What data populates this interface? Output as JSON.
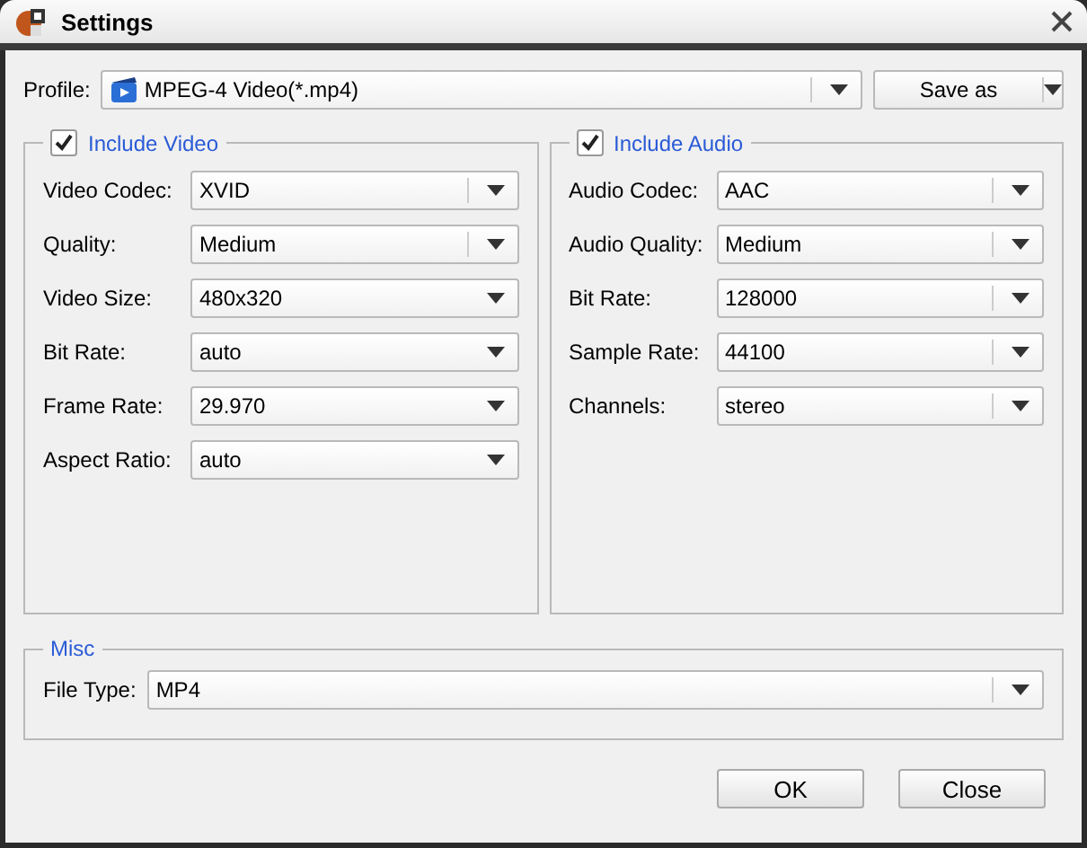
{
  "window": {
    "title": "Settings"
  },
  "profile": {
    "label": "Profile:",
    "value": "MPEG-4 Video(*.mp4)"
  },
  "save_as": {
    "label": "Save as"
  },
  "groups": [
    {
      "title": "Include Video",
      "checked": true,
      "fields": [
        {
          "label": "Video Codec:",
          "value": "XVID",
          "kind": "combo"
        },
        {
          "label": "Quality:",
          "value": "Medium",
          "kind": "combo"
        },
        {
          "label": "Video Size:",
          "value": "480x320",
          "kind": "list"
        },
        {
          "label": "Bit Rate:",
          "value": "auto",
          "kind": "list"
        },
        {
          "label": "Frame Rate:",
          "value": "29.970",
          "kind": "list"
        },
        {
          "label": "Aspect Ratio:",
          "value": "auto",
          "kind": "list"
        }
      ]
    },
    {
      "title": "Include Audio",
      "checked": true,
      "fields": [
        {
          "label": "Audio Codec:",
          "value": "AAC",
          "kind": "combo"
        },
        {
          "label": "Audio Quality:",
          "value": "Medium",
          "kind": "combo"
        },
        {
          "label": "Bit Rate:",
          "value": "128000",
          "kind": "combo"
        },
        {
          "label": "Sample Rate:",
          "value": "44100",
          "kind": "combo"
        },
        {
          "label": "Channels:",
          "value": "stereo",
          "kind": "combo"
        }
      ]
    }
  ],
  "misc": {
    "title": "Misc",
    "fields": [
      {
        "label": "File Type:",
        "value": "MP4",
        "kind": "combo"
      }
    ]
  },
  "buttons": [
    "OK",
    "Close"
  ]
}
